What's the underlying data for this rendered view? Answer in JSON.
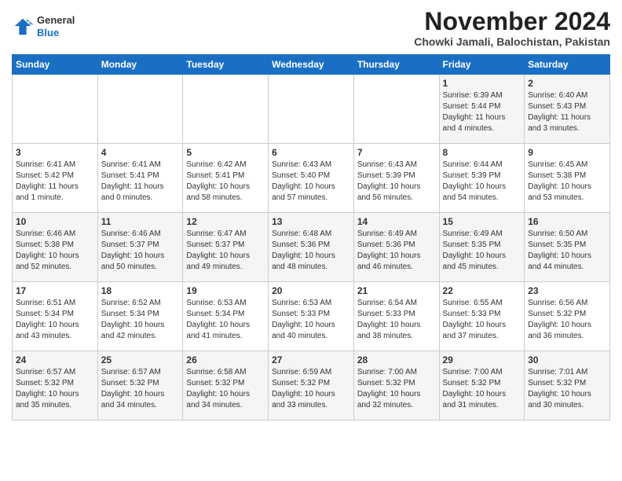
{
  "header": {
    "logo_line1": "General",
    "logo_line2": "Blue",
    "month": "November 2024",
    "location": "Chowki Jamali, Balochistan, Pakistan"
  },
  "weekdays": [
    "Sunday",
    "Monday",
    "Tuesday",
    "Wednesday",
    "Thursday",
    "Friday",
    "Saturday"
  ],
  "weeks": [
    [
      {
        "day": "",
        "info": ""
      },
      {
        "day": "",
        "info": ""
      },
      {
        "day": "",
        "info": ""
      },
      {
        "day": "",
        "info": ""
      },
      {
        "day": "",
        "info": ""
      },
      {
        "day": "1",
        "info": "Sunrise: 6:39 AM\nSunset: 5:44 PM\nDaylight: 11 hours\nand 4 minutes."
      },
      {
        "day": "2",
        "info": "Sunrise: 6:40 AM\nSunset: 5:43 PM\nDaylight: 11 hours\nand 3 minutes."
      }
    ],
    [
      {
        "day": "3",
        "info": "Sunrise: 6:41 AM\nSunset: 5:42 PM\nDaylight: 11 hours\nand 1 minute."
      },
      {
        "day": "4",
        "info": "Sunrise: 6:41 AM\nSunset: 5:41 PM\nDaylight: 11 hours\nand 0 minutes."
      },
      {
        "day": "5",
        "info": "Sunrise: 6:42 AM\nSunset: 5:41 PM\nDaylight: 10 hours\nand 58 minutes."
      },
      {
        "day": "6",
        "info": "Sunrise: 6:43 AM\nSunset: 5:40 PM\nDaylight: 10 hours\nand 57 minutes."
      },
      {
        "day": "7",
        "info": "Sunrise: 6:43 AM\nSunset: 5:39 PM\nDaylight: 10 hours\nand 56 minutes."
      },
      {
        "day": "8",
        "info": "Sunrise: 6:44 AM\nSunset: 5:39 PM\nDaylight: 10 hours\nand 54 minutes."
      },
      {
        "day": "9",
        "info": "Sunrise: 6:45 AM\nSunset: 5:38 PM\nDaylight: 10 hours\nand 53 minutes."
      }
    ],
    [
      {
        "day": "10",
        "info": "Sunrise: 6:46 AM\nSunset: 5:38 PM\nDaylight: 10 hours\nand 52 minutes."
      },
      {
        "day": "11",
        "info": "Sunrise: 6:46 AM\nSunset: 5:37 PM\nDaylight: 10 hours\nand 50 minutes."
      },
      {
        "day": "12",
        "info": "Sunrise: 6:47 AM\nSunset: 5:37 PM\nDaylight: 10 hours\nand 49 minutes."
      },
      {
        "day": "13",
        "info": "Sunrise: 6:48 AM\nSunset: 5:36 PM\nDaylight: 10 hours\nand 48 minutes."
      },
      {
        "day": "14",
        "info": "Sunrise: 6:49 AM\nSunset: 5:36 PM\nDaylight: 10 hours\nand 46 minutes."
      },
      {
        "day": "15",
        "info": "Sunrise: 6:49 AM\nSunset: 5:35 PM\nDaylight: 10 hours\nand 45 minutes."
      },
      {
        "day": "16",
        "info": "Sunrise: 6:50 AM\nSunset: 5:35 PM\nDaylight: 10 hours\nand 44 minutes."
      }
    ],
    [
      {
        "day": "17",
        "info": "Sunrise: 6:51 AM\nSunset: 5:34 PM\nDaylight: 10 hours\nand 43 minutes."
      },
      {
        "day": "18",
        "info": "Sunrise: 6:52 AM\nSunset: 5:34 PM\nDaylight: 10 hours\nand 42 minutes."
      },
      {
        "day": "19",
        "info": "Sunrise: 6:53 AM\nSunset: 5:34 PM\nDaylight: 10 hours\nand 41 minutes."
      },
      {
        "day": "20",
        "info": "Sunrise: 6:53 AM\nSunset: 5:33 PM\nDaylight: 10 hours\nand 40 minutes."
      },
      {
        "day": "21",
        "info": "Sunrise: 6:54 AM\nSunset: 5:33 PM\nDaylight: 10 hours\nand 38 minutes."
      },
      {
        "day": "22",
        "info": "Sunrise: 6:55 AM\nSunset: 5:33 PM\nDaylight: 10 hours\nand 37 minutes."
      },
      {
        "day": "23",
        "info": "Sunrise: 6:56 AM\nSunset: 5:32 PM\nDaylight: 10 hours\nand 36 minutes."
      }
    ],
    [
      {
        "day": "24",
        "info": "Sunrise: 6:57 AM\nSunset: 5:32 PM\nDaylight: 10 hours\nand 35 minutes."
      },
      {
        "day": "25",
        "info": "Sunrise: 6:57 AM\nSunset: 5:32 PM\nDaylight: 10 hours\nand 34 minutes."
      },
      {
        "day": "26",
        "info": "Sunrise: 6:58 AM\nSunset: 5:32 PM\nDaylight: 10 hours\nand 34 minutes."
      },
      {
        "day": "27",
        "info": "Sunrise: 6:59 AM\nSunset: 5:32 PM\nDaylight: 10 hours\nand 33 minutes."
      },
      {
        "day": "28",
        "info": "Sunrise: 7:00 AM\nSunset: 5:32 PM\nDaylight: 10 hours\nand 32 minutes."
      },
      {
        "day": "29",
        "info": "Sunrise: 7:00 AM\nSunset: 5:32 PM\nDaylight: 10 hours\nand 31 minutes."
      },
      {
        "day": "30",
        "info": "Sunrise: 7:01 AM\nSunset: 5:32 PM\nDaylight: 10 hours\nand 30 minutes."
      }
    ]
  ]
}
